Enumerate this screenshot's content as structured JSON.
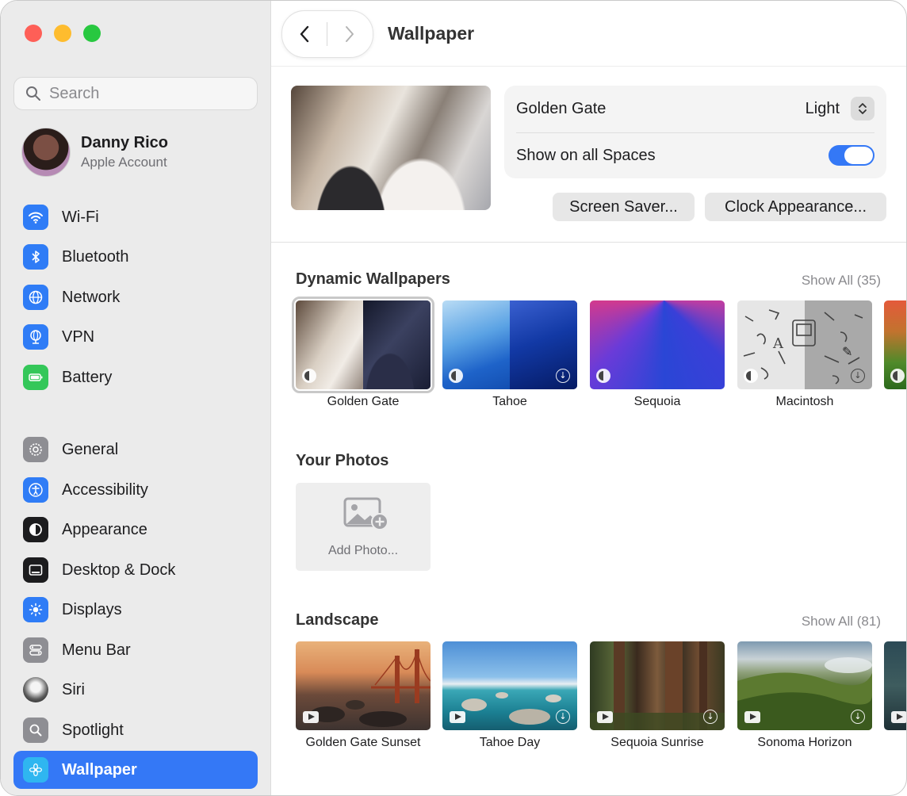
{
  "window": {
    "traffic_lights": [
      "close",
      "minimize",
      "zoom"
    ]
  },
  "sidebar": {
    "search_placeholder": "Search",
    "account": {
      "name": "Danny Rico",
      "subtitle": "Apple Account"
    },
    "group1": [
      {
        "label": "Wi-Fi",
        "icon": "wifi-icon",
        "color": "#2f7cf6"
      },
      {
        "label": "Bluetooth",
        "icon": "bluetooth-icon",
        "color": "#2f7cf6"
      },
      {
        "label": "Network",
        "icon": "globe-icon",
        "color": "#2f7cf6"
      },
      {
        "label": "VPN",
        "icon": "vpn-globe-icon",
        "color": "#2f7cf6"
      },
      {
        "label": "Battery",
        "icon": "battery-icon",
        "color": "#34c759"
      }
    ],
    "group2": [
      {
        "label": "General",
        "icon": "gear-icon",
        "color": "#8e8e93"
      },
      {
        "label": "Accessibility",
        "icon": "accessibility-icon",
        "color": "#2f7cf6"
      },
      {
        "label": "Appearance",
        "icon": "appearance-icon",
        "color": "#1c1c1e"
      },
      {
        "label": "Desktop & Dock",
        "icon": "dock-icon",
        "color": "#1c1c1e"
      },
      {
        "label": "Displays",
        "icon": "sun-icon",
        "color": "#2f7cf6"
      },
      {
        "label": "Menu Bar",
        "icon": "menubar-icon",
        "color": "#8e8e93"
      },
      {
        "label": "Siri",
        "icon": "siri-icon",
        "color": "#1c1c1e"
      },
      {
        "label": "Spotlight",
        "icon": "magnifier-icon",
        "color": "#8e8e93"
      },
      {
        "label": "Wallpaper",
        "icon": "flower-icon",
        "color": "#2fb6f0",
        "active": true
      }
    ]
  },
  "header": {
    "title": "Wallpaper",
    "back": "back",
    "forward": "forward"
  },
  "current": {
    "name": "Golden Gate",
    "appearance": "Light",
    "show_all_spaces_label": "Show on all Spaces",
    "show_all_spaces": true,
    "screen_saver_button": "Screen Saver...",
    "clock_button": "Clock Appearance..."
  },
  "dynamic": {
    "title": "Dynamic Wallpapers",
    "show_all": "Show All (35)",
    "items": [
      "Golden Gate",
      "Tahoe",
      "Sequoia",
      "Macintosh"
    ]
  },
  "photos": {
    "title": "Your Photos",
    "add_label": "Add Photo..."
  },
  "landscape": {
    "title": "Landscape",
    "show_all": "Show All (81)",
    "items": [
      "Golden Gate Sunset",
      "Tahoe Day",
      "Sequoia Sunrise",
      "Sonoma Horizon"
    ]
  },
  "colors": {
    "accent": "#3478f6",
    "sidebar_bg": "#ebebeb"
  }
}
